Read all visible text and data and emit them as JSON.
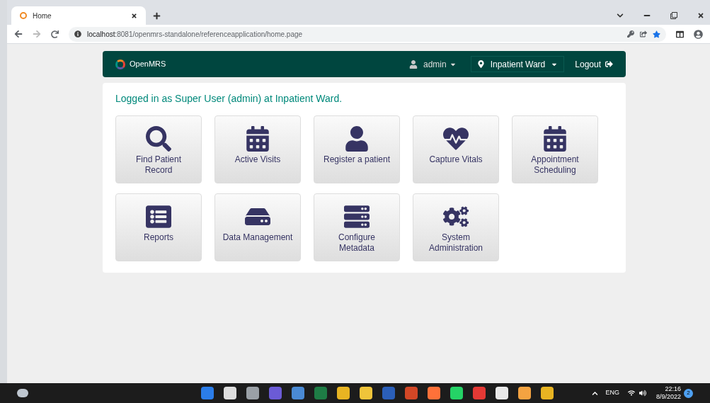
{
  "browser": {
    "tab_title": "Home",
    "url_host": "localhost",
    "url_rest": ":8081/openmrs-standalone/referenceapplication/home.page"
  },
  "header": {
    "brand": "OpenMRS",
    "user": "admin",
    "location": "Inpatient Ward",
    "logout": "Logout"
  },
  "welcome": "Logged in as Super User (admin) at Inpatient Ward.",
  "tiles": [
    {
      "lines": [
        "Find Patient",
        "Record"
      ],
      "kind": "search"
    },
    {
      "lines": [
        "Active Visits"
      ],
      "kind": "calendar"
    },
    {
      "lines": [
        "Register a patient"
      ],
      "kind": "user"
    },
    {
      "lines": [
        "Capture Vitals"
      ],
      "kind": "heart"
    },
    {
      "lines": [
        "Appointment",
        "Scheduling"
      ],
      "kind": "calendar"
    },
    {
      "lines": [
        "Reports"
      ],
      "kind": "list"
    },
    {
      "lines": [
        "Data Management"
      ],
      "kind": "drive"
    },
    {
      "lines": [
        "Configure",
        "Metadata"
      ],
      "kind": "server"
    },
    {
      "lines": [
        "System",
        "Administration"
      ],
      "kind": "gears"
    }
  ],
  "taskbar": {
    "language": "ENG",
    "time": "22:16",
    "date": "8/9/2022",
    "notifications": "2"
  }
}
